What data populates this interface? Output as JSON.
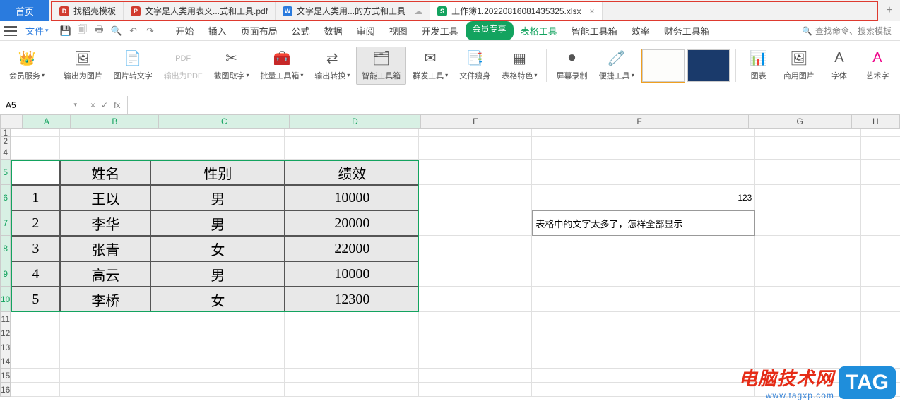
{
  "topbar": {
    "home": "首页",
    "tabs": [
      {
        "icon": "red",
        "glyph": "D",
        "label": "找稻壳模板"
      },
      {
        "icon": "red",
        "glyph": "P",
        "label": "文字是人类用表义...式和工具.pdf"
      },
      {
        "icon": "blue",
        "glyph": "W",
        "label": "文字是人类用...的方式和工具",
        "cloud": true
      },
      {
        "icon": "green",
        "glyph": "S",
        "label": "工作簿1.20220816081435325.xlsx",
        "active": true,
        "close": true
      }
    ]
  },
  "menu": {
    "file": "文件",
    "tabs": [
      "开始",
      "插入",
      "页面布局",
      "公式",
      "数据",
      "审阅",
      "视图",
      "开发工具"
    ],
    "vip": "会员专享",
    "extra": [
      "表格工具",
      "智能工具箱",
      "效率",
      "财务工具箱"
    ],
    "search_placeholder": "查找命令、搜索模板"
  },
  "ribbon": {
    "items": [
      {
        "label": "会员服务",
        "dd": true,
        "icon": "👑"
      },
      {
        "label": "输出为图片",
        "icon": "🖼"
      },
      {
        "label": "图片转文字",
        "icon": "📄"
      },
      {
        "label": "输出为PDF",
        "gray": true,
        "icon": "PDF"
      },
      {
        "label": "截图取字",
        "dd": true,
        "icon": "✂"
      },
      {
        "label": "批量工具箱",
        "dd": true,
        "icon": "🧰"
      },
      {
        "label": "输出转换",
        "dd": true,
        "icon": "⇄"
      },
      {
        "label": "智能工具箱",
        "active": true,
        "icon": "🗂"
      },
      {
        "label": "群发工具",
        "dd": true,
        "icon": "✉"
      },
      {
        "label": "文件瘦身",
        "icon": "📑"
      },
      {
        "label": "表格特色",
        "dd": true,
        "icon": "▦"
      },
      {
        "label": "屏幕录制",
        "icon": "⏺"
      },
      {
        "label": "便捷工具",
        "dd": true,
        "icon": "🧷"
      },
      {
        "label": "图表",
        "icon": "📊"
      },
      {
        "label": "商用图片",
        "icon": "🖼"
      },
      {
        "label": "字体",
        "icon": "A"
      },
      {
        "label": "艺术字",
        "icon": "A"
      }
    ]
  },
  "namebox": "A5",
  "fx_placeholder": "fx",
  "columns": [
    "A",
    "B",
    "C",
    "D",
    "E",
    "F",
    "G",
    "H"
  ],
  "rows_selected": [
    "5",
    "6",
    "7",
    "8",
    "9",
    "10"
  ],
  "rows_before": [
    "1",
    "2",
    "4"
  ],
  "rows_after": [
    "11",
    "12",
    "13",
    "14",
    "15",
    "16"
  ],
  "table": {
    "headers": [
      "",
      "姓名",
      "性别",
      "绩效"
    ],
    "rows": [
      [
        "1",
        "王以",
        "男",
        "10000"
      ],
      [
        "2",
        "李华",
        "男",
        "20000"
      ],
      [
        "3",
        "张青",
        "女",
        "22000"
      ],
      [
        "4",
        "高云",
        "男",
        "10000"
      ],
      [
        "5",
        "李桥",
        "女",
        "12300"
      ]
    ]
  },
  "cells": {
    "F6": "123",
    "F7": "表格中的文字太多了，怎样全部显示"
  },
  "watermark": {
    "line1": "电脑技术网",
    "line2": "www.tagxp.com",
    "tag": "TAG"
  },
  "glyphs": {
    "close": "×",
    "cloud": "☁",
    "plus": "+",
    "check": "✓",
    "search": "🔍"
  }
}
